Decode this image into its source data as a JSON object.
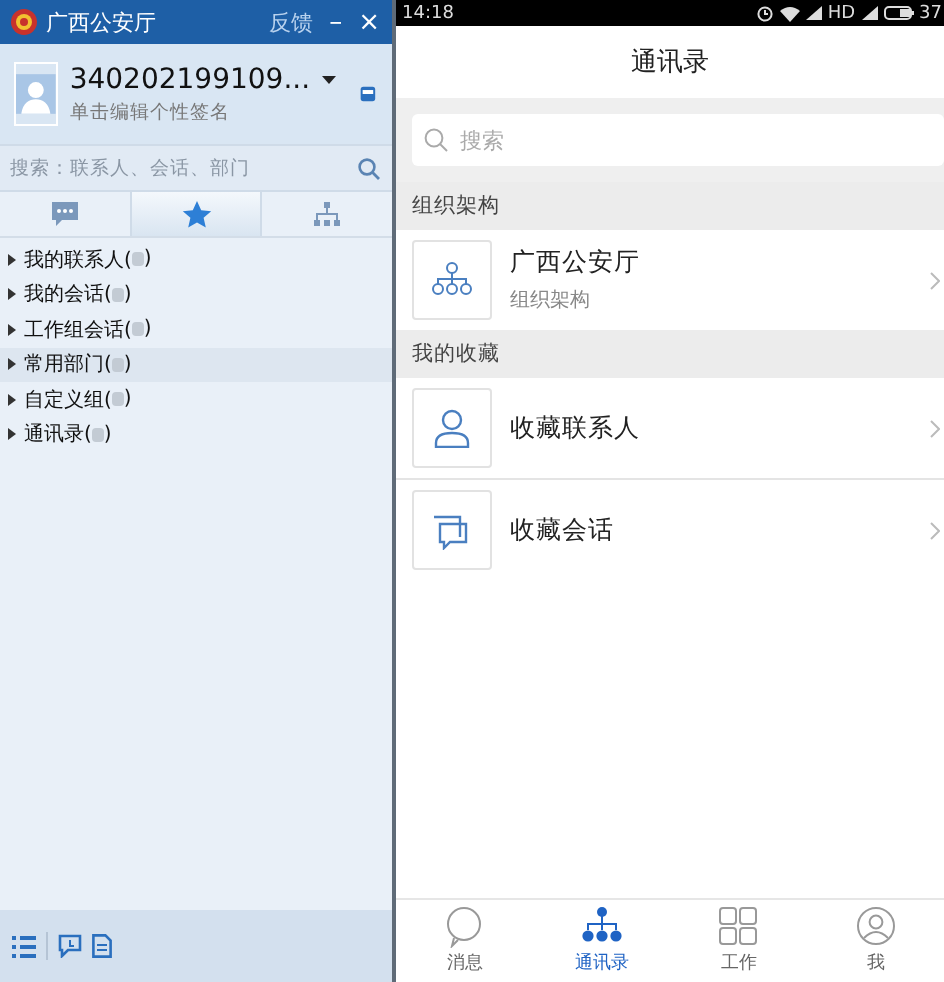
{
  "desktop": {
    "window": {
      "title": "广西公安厅",
      "feedback": "反馈",
      "minimize": "–",
      "close": "×"
    },
    "profile": {
      "name": "340202199109...",
      "signature": "单击编辑个性签名"
    },
    "search": {
      "placeholder": "搜索：联系人、会话、部门"
    },
    "tabs": [
      {
        "kind": "chat",
        "selected": false
      },
      {
        "kind": "star",
        "selected": true
      },
      {
        "kind": "org",
        "selected": false
      }
    ],
    "tree": [
      {
        "label": "我的联系人(",
        "close": ")",
        "selected": false
      },
      {
        "label": "我的会话(",
        "close": ")",
        "selected": false
      },
      {
        "label": "工作组会话(",
        "close": ")",
        "selected": false
      },
      {
        "label": "常用部门(",
        "close": ")",
        "selected": true
      },
      {
        "label": "自定义组(",
        "close": ")",
        "selected": false
      },
      {
        "label": "通讯录(",
        "close": ")",
        "selected": false
      }
    ]
  },
  "mobile": {
    "status_bar": {
      "time": "14:18",
      "network": "HD",
      "battery": "37"
    },
    "title": "通讯录",
    "search": {
      "placeholder": "搜索"
    },
    "sections": [
      {
        "header": "组织架构",
        "items": [
          {
            "kind": "org",
            "title": "广西公安厅",
            "subtitle": "组织架构"
          }
        ]
      },
      {
        "header": "我的收藏",
        "items": [
          {
            "kind": "contact",
            "title": "收藏联系人"
          },
          {
            "kind": "chat",
            "title": "收藏会话"
          }
        ]
      }
    ],
    "nav": [
      {
        "kind": "chat",
        "label": "消息",
        "selected": false
      },
      {
        "kind": "org",
        "label": "通讯录",
        "selected": true
      },
      {
        "kind": "grid",
        "label": "工作",
        "selected": false
      },
      {
        "kind": "user",
        "label": "我",
        "selected": false
      }
    ]
  }
}
